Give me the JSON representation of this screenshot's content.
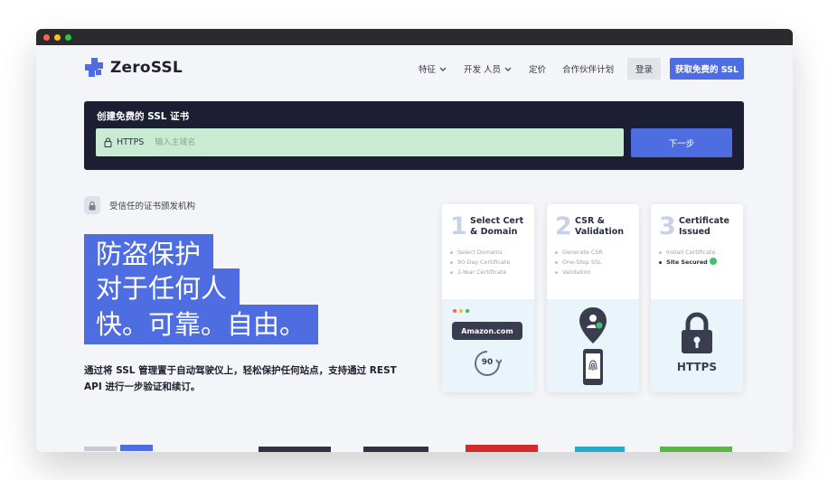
{
  "brand": {
    "name": "ZeroSSL"
  },
  "nav": {
    "links": [
      "特征",
      "开发 人员",
      "定价",
      "合作伙伴计划"
    ],
    "login": "登录",
    "cta": "获取免费的 SSL"
  },
  "create": {
    "title": "创建免费的 SSL 证书",
    "protocol": "HTTPS",
    "placeholder": "输入主域名",
    "button": "下一步"
  },
  "hero": {
    "trusted": "受信任的证书颁发机构",
    "lines": [
      "防盗保护",
      "对于任何人",
      "快。可靠。自由。"
    ],
    "description": "通过将 SSL 管理置于自动驾驶仪上，轻松保护任何站点，支持通过 REST API 进行一步验证和续订。"
  },
  "steps": [
    {
      "num": "1",
      "title1": "Select Cert",
      "title2": "& Domain",
      "items": [
        "Select Domains",
        "90-Day Certificate",
        "1-Year Certificate"
      ],
      "badge": "Amazon.com",
      "days": "90"
    },
    {
      "num": "2",
      "title1": "CSR &",
      "title2": "Validation",
      "items": [
        "Generate CSR",
        "One-Step SSL",
        "Validation"
      ]
    },
    {
      "num": "3",
      "title1": "Certificate",
      "title2": "Issued",
      "items": [
        "Install Certificate",
        "Site Secured"
      ],
      "badge": "HTTPS"
    }
  ],
  "colors": {
    "accent": "#4e6de0",
    "panel": "#1c1e34",
    "input_bg": "#c9ebd3",
    "check": "#3fc26a"
  }
}
